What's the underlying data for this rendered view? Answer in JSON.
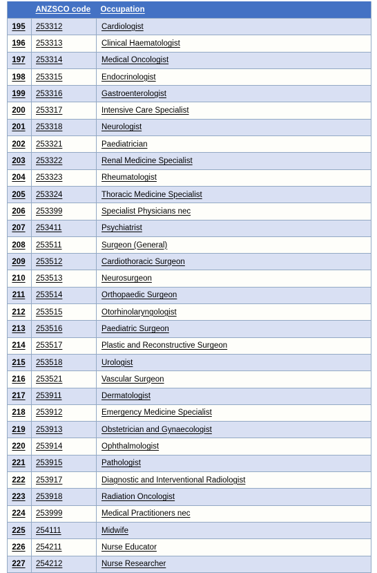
{
  "table": {
    "columns": [
      {
        "key": "index",
        "label": ""
      },
      {
        "key": "code",
        "label": "ANZSCO code"
      },
      {
        "key": "occupation",
        "label": "Occupation"
      }
    ],
    "header_background": "#4472C4",
    "header_text_color": "#FFFFFF",
    "row_alt_background": "#D9E0F3",
    "row_background": "#FEFEFA",
    "border_color": "#93A9C4",
    "rows": [
      {
        "index": "195",
        "code": "253312",
        "occupation": "Cardiologist"
      },
      {
        "index": "196",
        "code": "253313",
        "occupation": "Clinical Haematologist"
      },
      {
        "index": "197",
        "code": "253314",
        "occupation": "Medical Oncologist"
      },
      {
        "index": "198",
        "code": "253315",
        "occupation": "Endocrinologist"
      },
      {
        "index": "199",
        "code": "253316",
        "occupation": "Gastroenterologist"
      },
      {
        "index": "200",
        "code": "253317",
        "occupation": "Intensive Care Specialist"
      },
      {
        "index": "201",
        "code": "253318",
        "occupation": "Neurologist"
      },
      {
        "index": "202",
        "code": "253321",
        "occupation": "Paediatrician"
      },
      {
        "index": "203",
        "code": "253322",
        "occupation": "Renal Medicine Specialist"
      },
      {
        "index": "204",
        "code": "253323",
        "occupation": "Rheumatologist"
      },
      {
        "index": "205",
        "code": "253324",
        "occupation": "Thoracic Medicine Specialist"
      },
      {
        "index": "206",
        "code": "253399",
        "occupation": "Specialist Physicians nec"
      },
      {
        "index": "207",
        "code": "253411",
        "occupation": "Psychiatrist"
      },
      {
        "index": "208",
        "code": "253511",
        "occupation": "Surgeon (General)"
      },
      {
        "index": "209",
        "code": "253512",
        "occupation": "Cardiothoracic Surgeon"
      },
      {
        "index": "210",
        "code": "253513",
        "occupation": "Neurosurgeon"
      },
      {
        "index": "211",
        "code": "253514",
        "occupation": "Orthopaedic Surgeon"
      },
      {
        "index": "212",
        "code": "253515",
        "occupation": "Otorhinolaryngologist"
      },
      {
        "index": "213",
        "code": "253516",
        "occupation": "Paediatric Surgeon"
      },
      {
        "index": "214",
        "code": "253517",
        "occupation": "Plastic and Reconstructive Surgeon"
      },
      {
        "index": "215",
        "code": "253518",
        "occupation": "Urologist"
      },
      {
        "index": "216",
        "code": "253521",
        "occupation": "Vascular Surgeon"
      },
      {
        "index": "217",
        "code": "253911",
        "occupation": "Dermatologist"
      },
      {
        "index": "218",
        "code": "253912",
        "occupation": "Emergency Medicine Specialist"
      },
      {
        "index": "219",
        "code": "253913",
        "occupation": "Obstetrician and Gynaecologist"
      },
      {
        "index": "220",
        "code": "253914",
        "occupation": "Ophthalmologist"
      },
      {
        "index": "221",
        "code": "253915",
        "occupation": "Pathologist"
      },
      {
        "index": "222",
        "code": "253917",
        "occupation": "Diagnostic and Interventional Radiologist"
      },
      {
        "index": "223",
        "code": "253918",
        "occupation": "Radiation Oncologist"
      },
      {
        "index": "224",
        "code": "253999",
        "occupation": "Medical Practitioners nec"
      },
      {
        "index": "225",
        "code": "254111",
        "occupation": "Midwife"
      },
      {
        "index": "226",
        "code": "254211",
        "occupation": "Nurse Educator"
      },
      {
        "index": "227",
        "code": "254212",
        "occupation": "Nurse Researcher"
      }
    ]
  }
}
